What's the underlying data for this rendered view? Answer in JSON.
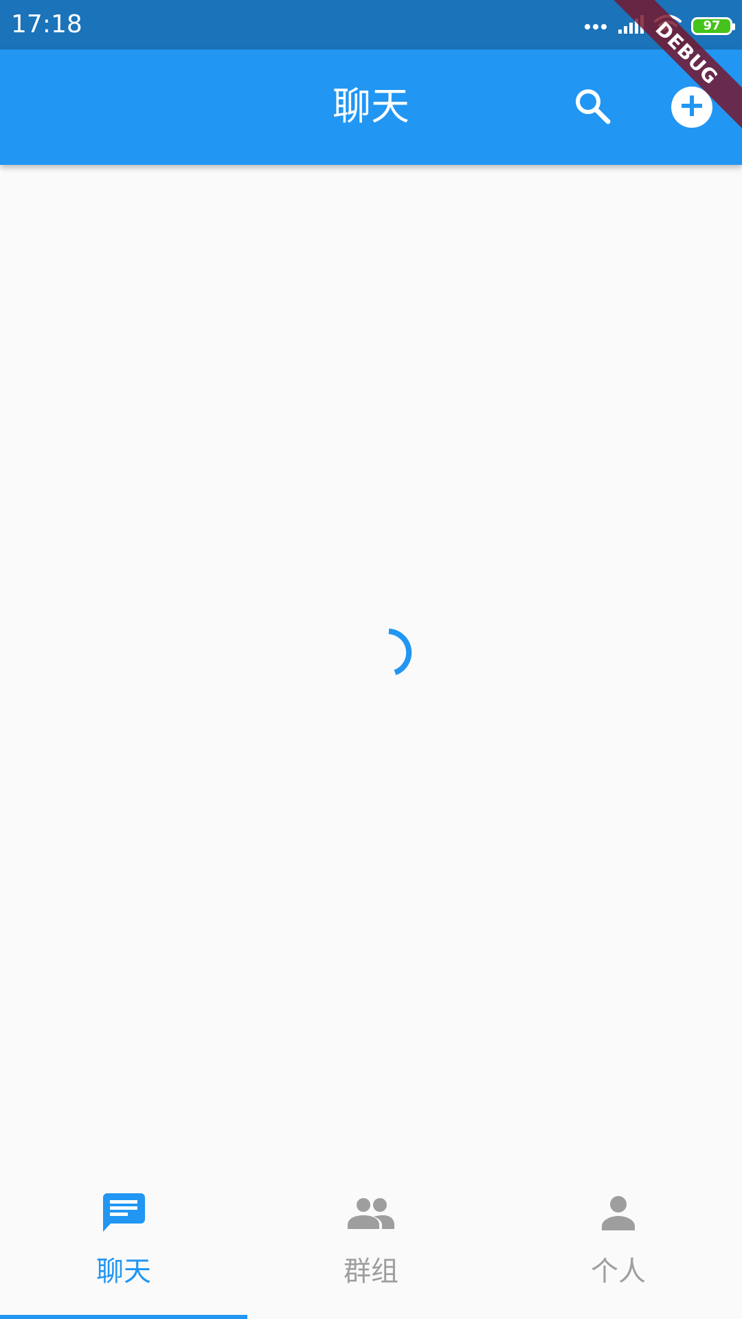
{
  "status_bar": {
    "time": "17:18",
    "battery_level": "97",
    "icons": [
      "more-dots-icon",
      "signal-icon",
      "wifi-icon",
      "battery-icon"
    ]
  },
  "debug_banner": {
    "label": "DEBUG"
  },
  "app_bar": {
    "title": "聊天",
    "actions": [
      "search-icon",
      "add-circle-icon"
    ]
  },
  "main": {
    "state": "loading"
  },
  "bottom_nav": {
    "items": [
      {
        "label": "聊天",
        "icon": "chat-icon",
        "active": true
      },
      {
        "label": "群组",
        "icon": "group-icon",
        "active": false
      },
      {
        "label": "个人",
        "icon": "person-icon",
        "active": false
      }
    ]
  },
  "colors": {
    "primary": "#2196f3",
    "status_bar": "#1b73ba",
    "inactive": "#9e9e9e",
    "background": "#fafafa"
  }
}
